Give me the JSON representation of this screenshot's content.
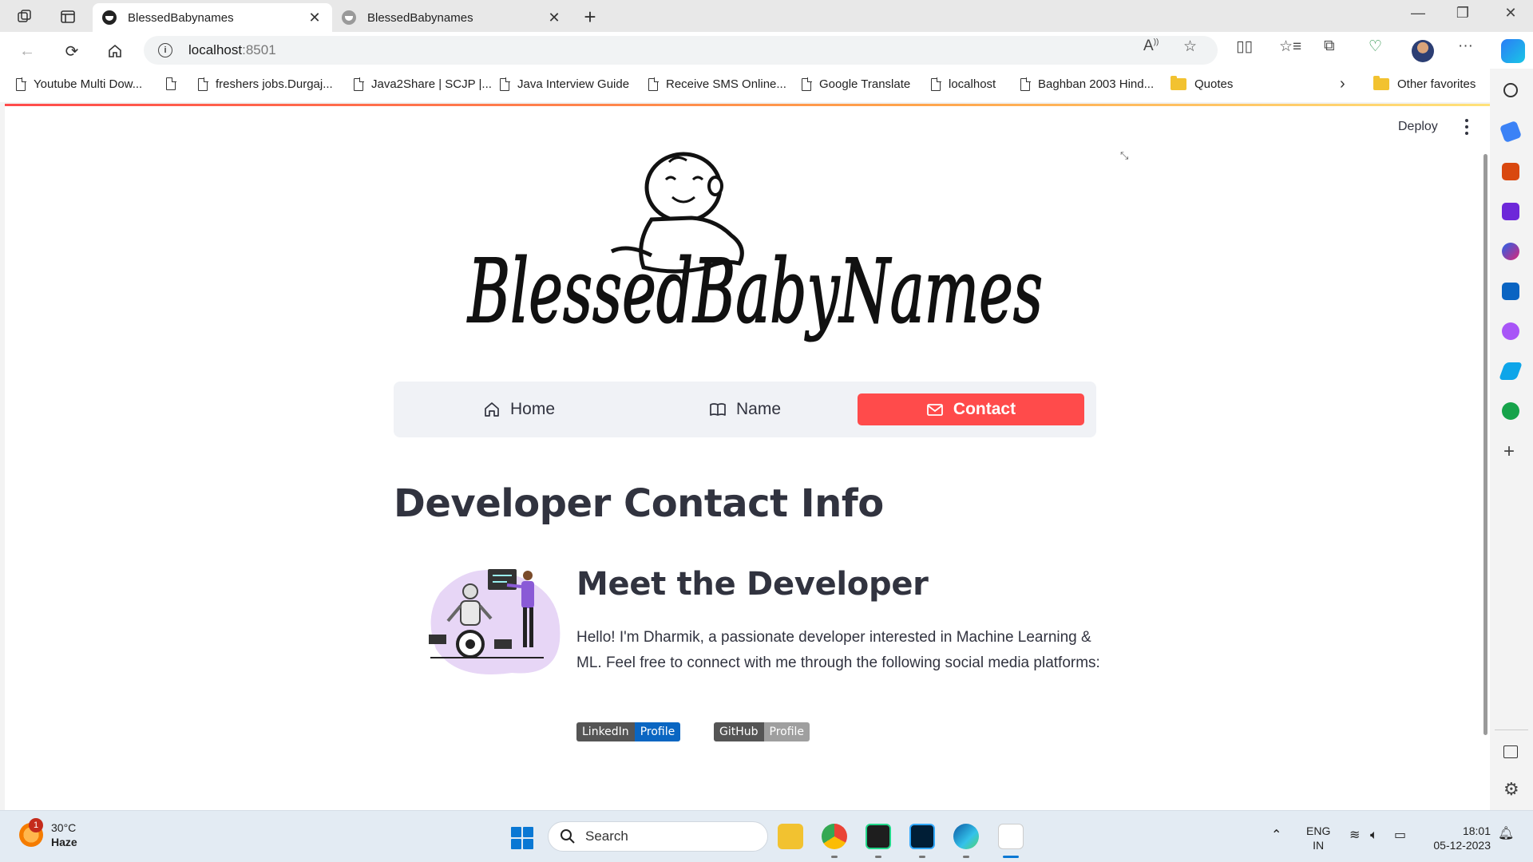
{
  "browser": {
    "tabs": [
      {
        "title": "BlessedBabynames",
        "active": true
      },
      {
        "title": "BlessedBabynames",
        "active": false
      }
    ],
    "url_host": "localhost",
    "url_port": ":8501",
    "favorites": [
      "Youtube Multi Dow...",
      "freshers jobs.Durgaj...",
      "Java2Share | SCJP |...",
      "Java Interview Guide",
      "Receive SMS Online...",
      "Google Translate",
      "localhost",
      "Baghban 2003 Hind...",
      "Quotes",
      "Other favorites"
    ]
  },
  "app": {
    "deploy_label": "Deploy",
    "logo_text": "BlessedBabyNames",
    "nav": {
      "home": "Home",
      "name": "Name",
      "contact": "Contact",
      "active": "contact",
      "accent_color": "#ff4b4b"
    },
    "page_title": "Developer Contact Info",
    "section_title": "Meet the Developer",
    "bio": "Hello! I'm Dharmik, a passionate developer interested in Machine Learning & ML. Feel free to connect with me through the following social media platforms:",
    "badges": [
      {
        "left": "LinkedIn",
        "right": "Profile",
        "color": "#0a66c2"
      },
      {
        "left": "GitHub",
        "right": "Profile",
        "color": "#9f9f9f"
      }
    ]
  },
  "taskbar": {
    "weather_temp": "30°C",
    "weather_desc": "Haze",
    "weather_badge": "1",
    "search_placeholder": "Search",
    "lang_top": "ENG",
    "lang_bottom": "IN",
    "time": "18:01",
    "date": "05-12-2023"
  }
}
